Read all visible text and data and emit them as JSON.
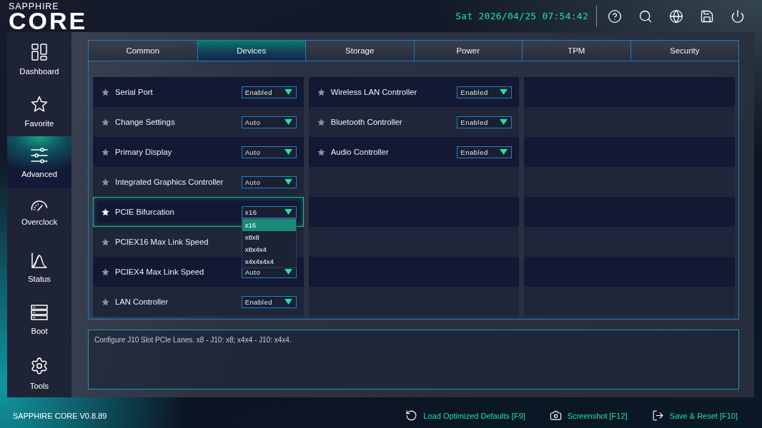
{
  "header": {
    "logo": {
      "brand": "SAPPHIRE",
      "product": "CORE"
    },
    "clock": "Sat 2026/04/25 07:54:42"
  },
  "sidebar": {
    "items": [
      {
        "label": "Dashboard",
        "selected": false
      },
      {
        "label": "Favorite",
        "selected": false
      },
      {
        "label": "Advanced",
        "selected": true
      },
      {
        "label": "Overclock",
        "selected": false
      },
      {
        "label": "Status",
        "selected": false
      },
      {
        "label": "Boot",
        "selected": false
      },
      {
        "label": "Tools",
        "selected": false
      }
    ]
  },
  "tabs": [
    {
      "label": "Common",
      "selected": false
    },
    {
      "label": "Devices",
      "selected": true
    },
    {
      "label": "Storage",
      "selected": false
    },
    {
      "label": "Power",
      "selected": false
    },
    {
      "label": "TPM",
      "selected": false
    },
    {
      "label": "Security",
      "selected": false
    }
  ],
  "settings": {
    "columns": [
      [
        {
          "label": "Serial Port",
          "value": "Enabled",
          "selected": false
        },
        {
          "label": "Change Settings",
          "value": "Auto",
          "selected": false
        },
        {
          "label": "Primary Display",
          "value": "Auto",
          "selected": false
        },
        {
          "label": "Integrated Graphics Controller",
          "value": "Auto",
          "selected": false
        },
        {
          "label": "PCIE Bifurcation",
          "value": "x16",
          "selected": true,
          "options": [
            {
              "label": "x16",
              "selected": true
            },
            {
              "label": "x8x8",
              "selected": false
            },
            {
              "label": "x8x4x4",
              "selected": false
            },
            {
              "label": "x4x4x4x4",
              "selected": false
            }
          ]
        },
        {
          "label": "PCIEX16 Max Link Speed",
          "selected": false
        },
        {
          "label": "PCIEX4 Max Link Speed",
          "value": "Auto",
          "selected": false
        },
        {
          "label": "LAN Controller",
          "value": "Enabled",
          "selected": false
        }
      ],
      [
        {
          "label": "Wireless LAN Controller",
          "value": "Enabled",
          "selected": false
        },
        {
          "label": "Bluetooth Controller",
          "value": "Enabled",
          "selected": false
        },
        {
          "label": "Audio Controller",
          "value": "Enabled",
          "selected": false
        }
      ]
    ]
  },
  "description": "Configure J10 Slot PCIe Lanes. x8 - J10: x8; x4x4 - J10: x4x4.",
  "status_bar": {
    "version": "SAPPHIRE CORE V0.8.89",
    "actions": [
      {
        "label": "Load Optimized Defaults [F9]"
      },
      {
        "label": "Screenshot [F12]"
      },
      {
        "label": "Save & Reset [F10]"
      }
    ]
  }
}
